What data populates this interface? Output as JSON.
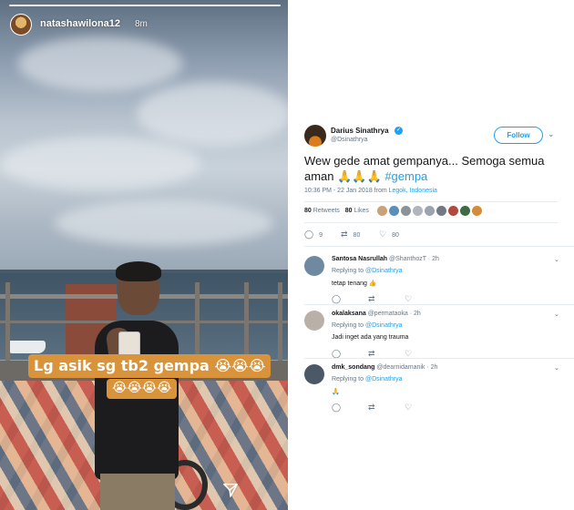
{
  "story": {
    "username": "natashawilona12",
    "time": "8m",
    "caption_line1": "Lg asik sg tb2 gempa 😭😭😭",
    "caption_line2": "😭😭😭😭",
    "send_icon": "paper-plane-icon"
  },
  "tweet": {
    "author_name": "Darius Sinathrya",
    "author_handle": "@Dsinathrya",
    "verified_icon": "verified-badge-icon",
    "follow_label": "Follow",
    "text_main": "Wew gede amat gempanya... Semoga semua aman 🙏🙏🙏 ",
    "hashtag": "#gempa",
    "time": "10:36 PM - 22 Jan 2018 from ",
    "location": "Legok, Indonesia",
    "retweets_count": "80",
    "retweets_label": "Retweets",
    "likes_count": "80",
    "likes_label": "Likes",
    "reply_count": "9",
    "retweet_count": "80",
    "like_count": "80",
    "liker_colors": [
      "#c9a27a",
      "#5b8fb9",
      "#8a9399",
      "#b0b6bb",
      "#9aa4ad",
      "#6f7a83",
      "#b04a3c",
      "#3e6b45",
      "#d48b3a"
    ]
  },
  "replies": [
    {
      "name": "Santosa Nasrullah",
      "handle": "@ShanthozT · 2h",
      "replying_prefix": "Replying to ",
      "replying_to": "@Dsinathrya",
      "text": "tetap tenang 👍",
      "avatar_color": "#6f8aa0"
    },
    {
      "name": "okalaksana",
      "handle": "@permataoka · 2h",
      "replying_prefix": "Replying to ",
      "replying_to": "@Dsinathrya",
      "text": "Jadi inget ada yang trauma",
      "avatar_color": "#b9b1a8"
    },
    {
      "name": "dmk_sondang",
      "handle": "@dearnidamanik · 2h",
      "replying_prefix": "Replying to ",
      "replying_to": "@Dsinathrya",
      "text": "🙏",
      "avatar_color": "#4b5866"
    }
  ]
}
